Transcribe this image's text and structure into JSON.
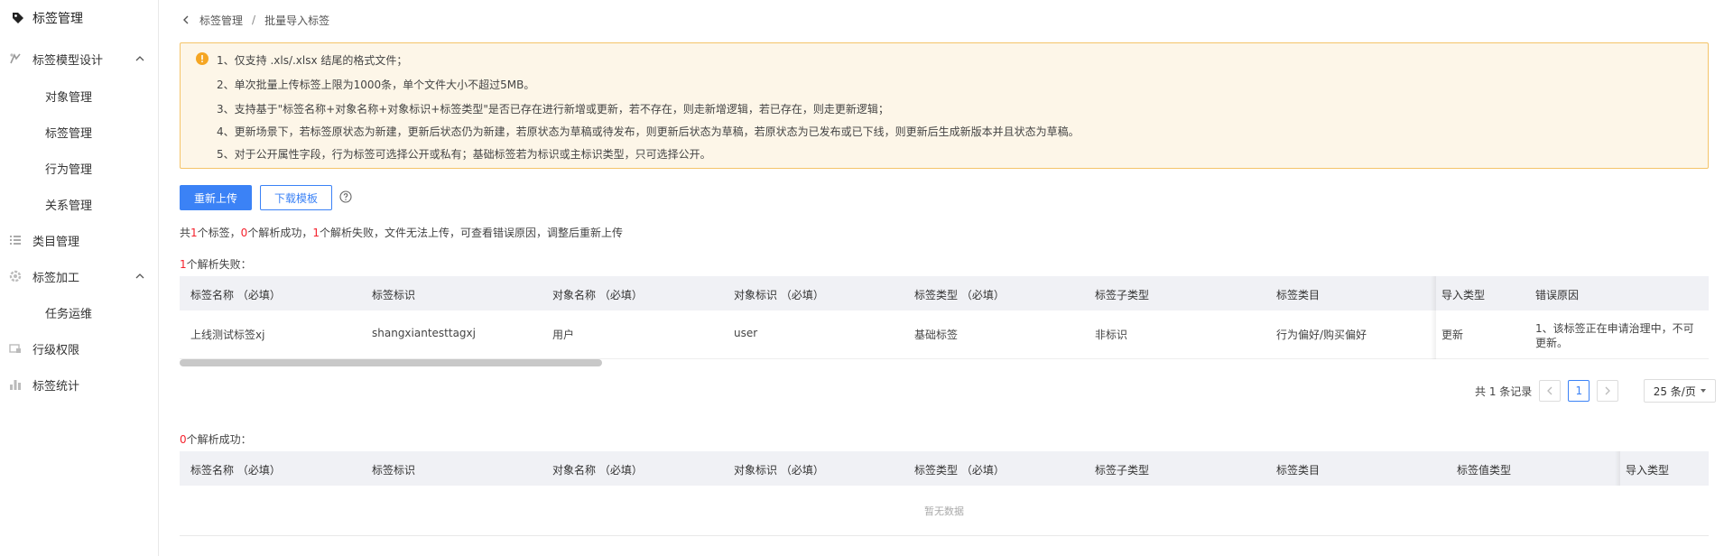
{
  "sidebar": {
    "title": "标签管理",
    "items": [
      {
        "label": "标签模型设计",
        "expandable": true
      },
      {
        "label": "对象管理"
      },
      {
        "label": "标签管理"
      },
      {
        "label": "行为管理"
      },
      {
        "label": "关系管理"
      },
      {
        "label": "类目管理"
      },
      {
        "label": "标签加工",
        "expandable": true
      },
      {
        "label": "任务运维"
      },
      {
        "label": "行级权限"
      },
      {
        "label": "标签统计"
      }
    ]
  },
  "breadcrumb": {
    "parent": "标签管理",
    "sep": "/",
    "current": "批量导入标签"
  },
  "notice": {
    "lines": [
      "1、仅支持 .xls/.xlsx 结尾的格式文件；",
      "2、单次批量上传标签上限为1000条，单个文件大小不超过5MB。",
      "3、支持基于\"标签名称+对象名称+对象标识+标签类型\"是否已存在进行新增或更新，若不存在，则走新增逻辑，若已存在，则走更新逻辑；",
      "4、更新场景下，若标签原状态为新建，更新后状态仍为新建，若原状态为草稿或待发布，则更新后状态为草稿，若原状态为已发布或已下线，则更新后生成新版本并且状态为草稿。",
      "5、对于公开属性字段，行为标签可选择公开或私有；基础标签若为标识或主标识类型，只可选择公开。"
    ]
  },
  "actions": {
    "reupload": "重新上传",
    "download_template": "下载模板"
  },
  "summary": {
    "p1": "共",
    "total": "1",
    "p2": "个标签，",
    "success": "0",
    "p3": "个解析成功，",
    "failed": "1",
    "p4": "个解析失败，文件无法上传，可查看错误原因，调整后重新上传"
  },
  "failed_section": {
    "count": "1",
    "label": "个解析失败："
  },
  "failed_table": {
    "columns": [
      "标签名称 （必填）",
      "标签标识",
      "对象名称 （必填）",
      "对象标识 （必填）",
      "标签类型 （必填）",
      "标签子类型",
      "标签类目",
      "导入类型",
      "错误原因"
    ],
    "row": [
      "上线测试标签xj",
      "shangxiantesttagxj",
      "用户",
      "user",
      "基础标签",
      "非标识",
      "行为偏好/购买偏好",
      "更新",
      "1、该标签正在申请治理中，不可",
      "更新。"
    ]
  },
  "pagination": {
    "total": "共 1 条记录",
    "page": "1",
    "page_size": "25 条/页"
  },
  "success_section": {
    "count": "0",
    "label": "个解析成功："
  },
  "success_table": {
    "columns": [
      "标签名称 （必填）",
      "标签标识",
      "对象名称 （必填）",
      "对象标识 （必填）",
      "标签类型 （必填）",
      "标签子类型",
      "标签类目",
      "标签值类型",
      "导入类型"
    ],
    "empty_text": "暂无数据"
  },
  "colors": {
    "primary": "#3b82f6",
    "error": "#f5222d",
    "notice_bg": "#fdf6e8",
    "notice_border": "#f4c469"
  }
}
